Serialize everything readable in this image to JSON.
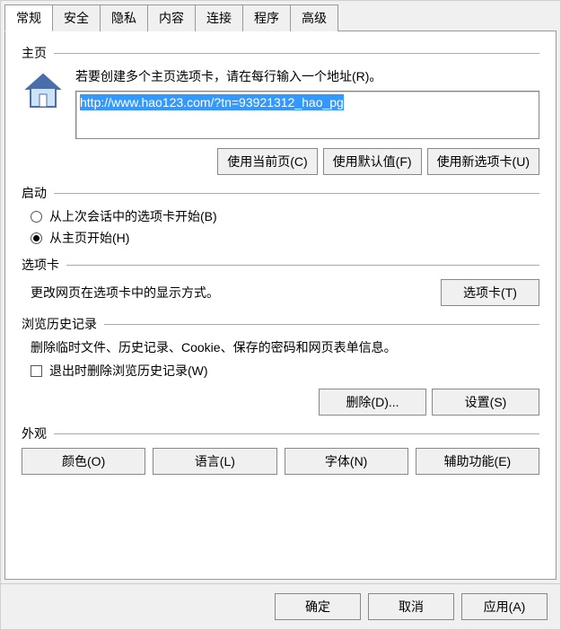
{
  "tabs": {
    "general": "常规",
    "security": "安全",
    "privacy": "隐私",
    "content": "内容",
    "connections": "连接",
    "programs": "程序",
    "advanced": "高级",
    "active": "general"
  },
  "homepage": {
    "group_label": "主页",
    "desc": "若要创建多个主页选项卡，请在每行输入一个地址(R)。",
    "url": "http://www.hao123.com/?tn=93921312_hao_pg",
    "btn_current": "使用当前页(C)",
    "btn_default": "使用默认值(F)",
    "btn_newtab": "使用新选项卡(U)"
  },
  "startup": {
    "group_label": "启动",
    "opt_last": "从上次会话中的选项卡开始(B)",
    "opt_home": "从主页开始(H)",
    "selected": "home"
  },
  "tabopts": {
    "group_label": "选项卡",
    "desc": "更改网页在选项卡中的显示方式。",
    "btn": "选项卡(T)"
  },
  "history": {
    "group_label": "浏览历史记录",
    "desc": "删除临时文件、历史记录、Cookie、保存的密码和网页表单信息。",
    "chk_exit": "退出时删除浏览历史记录(W)",
    "chk_exit_checked": false,
    "btn_delete": "删除(D)...",
    "btn_settings": "设置(S)"
  },
  "appearance": {
    "group_label": "外观",
    "btn_colors": "颜色(O)",
    "btn_lang": "语言(L)",
    "btn_fonts": "字体(N)",
    "btn_access": "辅助功能(E)"
  },
  "bottom": {
    "ok": "确定",
    "cancel": "取消",
    "apply": "应用(A)"
  }
}
